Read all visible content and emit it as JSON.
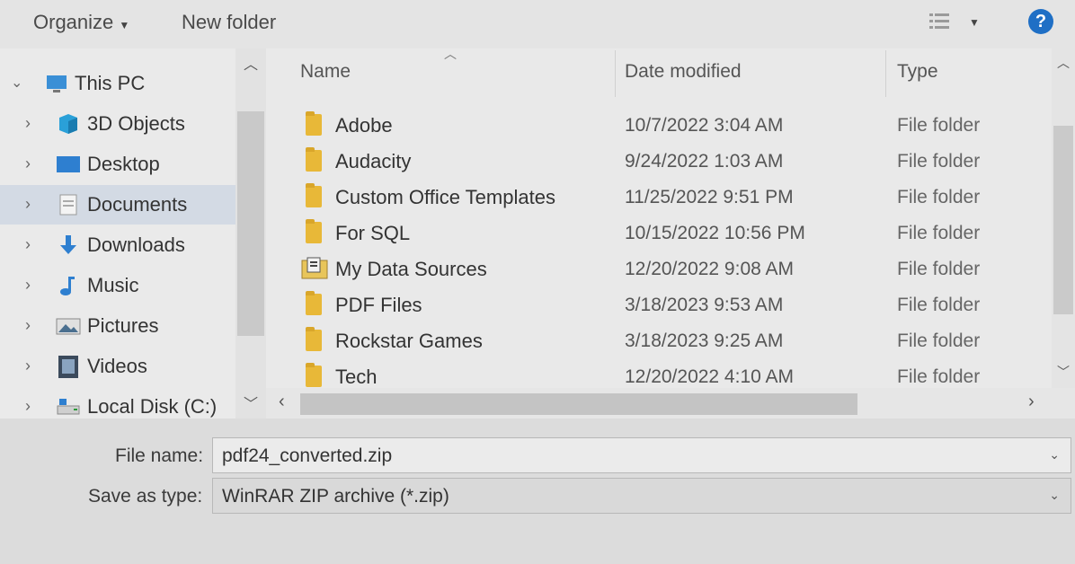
{
  "toolbar": {
    "organize_label": "Organize",
    "new_folder_label": "New folder",
    "help_label": "?"
  },
  "nav": {
    "items": [
      {
        "label": "This PC",
        "icon": "computer-icon"
      },
      {
        "label": "3D Objects",
        "icon": "3d-objects-icon"
      },
      {
        "label": "Desktop",
        "icon": "desktop-icon"
      },
      {
        "label": "Documents",
        "icon": "documents-icon",
        "selected": true
      },
      {
        "label": "Downloads",
        "icon": "download-arrow-icon"
      },
      {
        "label": "Music",
        "icon": "music-note-icon"
      },
      {
        "label": "Pictures",
        "icon": "pictures-icon"
      },
      {
        "label": "Videos",
        "icon": "videos-icon"
      },
      {
        "label": "Local Disk (C:)",
        "icon": "drive-icon"
      }
    ]
  },
  "columns": {
    "name": "Name",
    "date": "Date modified",
    "type": "Type"
  },
  "files": [
    {
      "name": "Adobe",
      "date": "10/7/2022 3:04 AM",
      "type": "File folder"
    },
    {
      "name": "Audacity",
      "date": "9/24/2022 1:03 AM",
      "type": "File folder"
    },
    {
      "name": "Custom Office Templates",
      "date": "11/25/2022 9:51 PM",
      "type": "File folder"
    },
    {
      "name": "For SQL",
      "date": "10/15/2022 10:56 PM",
      "type": "File folder"
    },
    {
      "name": "My Data Sources",
      "date": "12/20/2022 9:08 AM",
      "type": "File folder"
    },
    {
      "name": "PDF Files",
      "date": "3/18/2023 9:53 AM",
      "type": "File folder"
    },
    {
      "name": "Rockstar Games",
      "date": "3/18/2023 9:25 AM",
      "type": "File folder"
    },
    {
      "name": "Tech",
      "date": "12/20/2022 4:10 AM",
      "type": "File folder"
    }
  ],
  "save": {
    "file_name_label": "File name:",
    "file_name_value": "pdf24_converted.zip",
    "type_label": "Save as type:",
    "type_value": "WinRAR ZIP archive (*.zip)"
  },
  "colors": {
    "help_blue": "#1f6fc5",
    "selection": "#d3dae4",
    "folder_yellow": "#e8b838"
  }
}
